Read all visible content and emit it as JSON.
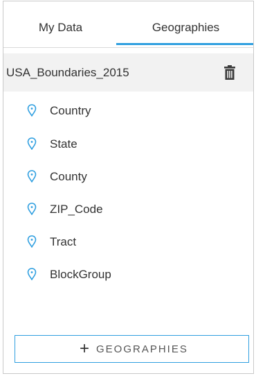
{
  "tabs": {
    "my_data": "My Data",
    "geographies": "Geographies"
  },
  "dataset": {
    "name": "USA_Boundaries_2015"
  },
  "fields": [
    {
      "label": "Country"
    },
    {
      "label": "State"
    },
    {
      "label": "County"
    },
    {
      "label": "ZIP_Code"
    },
    {
      "label": "Tract"
    },
    {
      "label": "BlockGroup"
    }
  ],
  "add_button": {
    "plus": "+",
    "label": "GEOGRAPHIES"
  },
  "colors": {
    "accent": "#2f9fe0",
    "row_bg": "#f2f2f2",
    "text": "#323232",
    "icon": "#2f9fe0"
  },
  "icons": {
    "trash": "trash-icon",
    "location_field": "location-pin-icon"
  },
  "selected_tab": "Geographies"
}
